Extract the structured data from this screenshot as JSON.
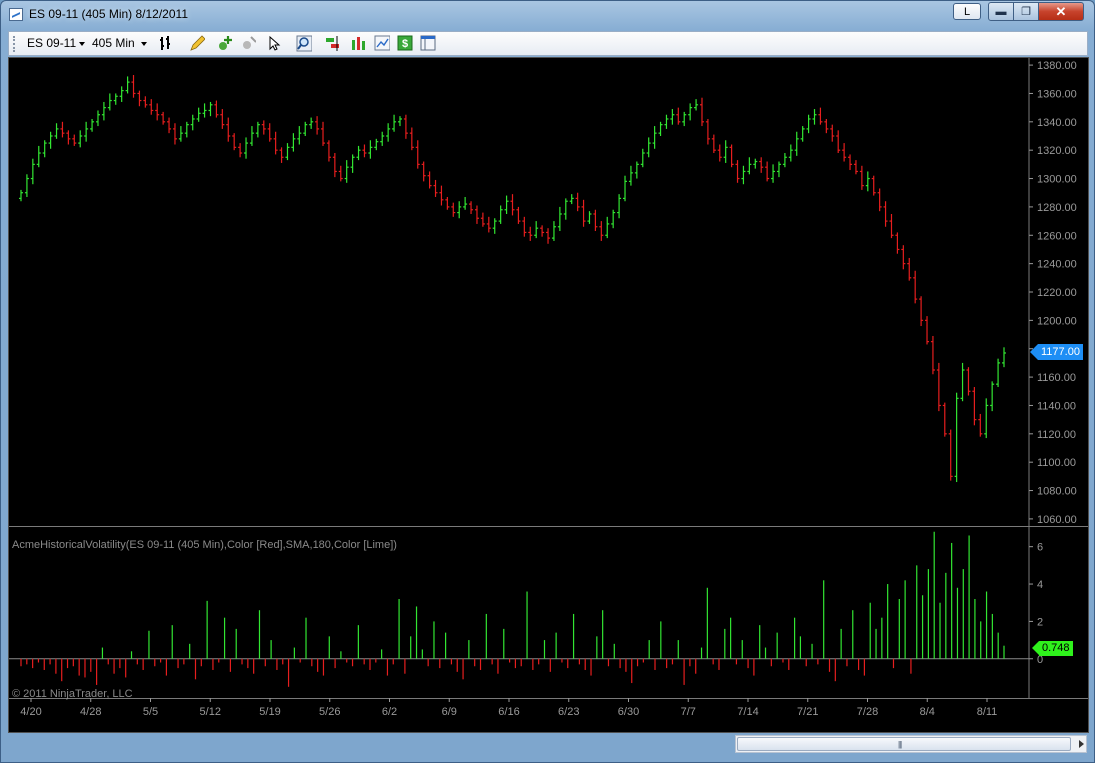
{
  "window": {
    "title": "ES 09-11 (405 Min)  8/12/2011",
    "btn_l": "L",
    "btn_min": "▬",
    "btn_max": "❐",
    "btn_close": "✕"
  },
  "toolbar": {
    "instrument": "ES 09-11",
    "interval": "405 Min",
    "icons": [
      "bar-type-icon",
      "pencil-draw-icon",
      "add-indicator-icon",
      "strategy-icon",
      "cursor-icon",
      "zoom-icon",
      "buy-sell-icon",
      "bar-chart-icon",
      "data-box-icon",
      "dollar-icon",
      "properties-icon"
    ]
  },
  "chart": {
    "indicator_label": "AcmeHistoricalVolatility(ES 09-11 (405 Min),Color [Red],SMA,180,Color [Lime])",
    "copyright": "© 2011 NinjaTrader, LLC",
    "last_price": "1177.00",
    "last_indicator": "0.748"
  },
  "chart_data": [
    {
      "type": "ohlc",
      "series_colors": {
        "up": "#32e632",
        "down": "#e61e1e"
      },
      "ylim": [
        1055,
        1385
      ],
      "y_ticks": [
        "1380.00",
        "1360.00",
        "1340.00",
        "1320.00",
        "1300.00",
        "1280.00",
        "1260.00",
        "1240.00",
        "1220.00",
        "1200.00",
        "1180.00",
        "1160.00",
        "1140.00",
        "1120.00",
        "1100.00",
        "1080.00",
        "1060.00"
      ],
      "x_ticks": [
        "4/20",
        "4/28",
        "5/5",
        "5/12",
        "5/19",
        "5/26",
        "6/2",
        "6/9",
        "6/16",
        "6/23",
        "6/30",
        "7/7",
        "7/14",
        "7/21",
        "7/28",
        "8/4",
        "8/11"
      ],
      "closes": [
        1290,
        1300,
        1310,
        1318,
        1325,
        1330,
        1335,
        1332,
        1328,
        1325,
        1330,
        1335,
        1340,
        1345,
        1350,
        1355,
        1358,
        1362,
        1368,
        1360,
        1355,
        1352,
        1348,
        1345,
        1340,
        1335,
        1328,
        1332,
        1338,
        1342,
        1346,
        1348,
        1352,
        1345,
        1338,
        1330,
        1322,
        1318,
        1325,
        1332,
        1338,
        1335,
        1328,
        1320,
        1315,
        1322,
        1328,
        1332,
        1338,
        1340,
        1335,
        1325,
        1315,
        1305,
        1300,
        1308,
        1315,
        1320,
        1318,
        1322,
        1326,
        1330,
        1335,
        1340,
        1342,
        1332,
        1322,
        1310,
        1302,
        1295,
        1290,
        1285,
        1280,
        1276,
        1280,
        1282,
        1278,
        1272,
        1268,
        1265,
        1270,
        1278,
        1284,
        1278,
        1270,
        1262,
        1260,
        1265,
        1262,
        1258,
        1266,
        1275,
        1284,
        1286,
        1280,
        1270,
        1275,
        1266,
        1260,
        1268,
        1276,
        1286,
        1298,
        1304,
        1310,
        1318,
        1325,
        1332,
        1338,
        1342,
        1345,
        1340,
        1345,
        1350,
        1352,
        1340,
        1328,
        1320,
        1315,
        1322,
        1310,
        1300,
        1305,
        1310,
        1312,
        1308,
        1300,
        1305,
        1310,
        1315,
        1320,
        1328,
        1335,
        1342,
        1345,
        1340,
        1335,
        1330,
        1320,
        1315,
        1310,
        1305,
        1295,
        1300,
        1290,
        1280,
        1270,
        1260,
        1250,
        1240,
        1230,
        1215,
        1200,
        1185,
        1165,
        1140,
        1120,
        1090,
        1145,
        1165,
        1150,
        1130,
        1120,
        1140,
        1155,
        1170,
        1177
      ],
      "volatility": [
        -0.4,
        -0.3,
        -0.5,
        -0.2,
        -0.6,
        -0.3,
        -0.8,
        -1.2,
        -0.5,
        -0.4,
        -0.9,
        -1.0,
        -0.7,
        -1.4,
        0.6,
        -0.3,
        -0.8,
        -0.5,
        -1.0,
        0.4,
        -0.3,
        -0.6,
        1.5,
        -0.4,
        -0.2,
        -0.9,
        1.8,
        -0.5,
        -0.3,
        0.8,
        -1.1,
        -0.4,
        3.1,
        -0.6,
        -0.2,
        2.2,
        -0.7,
        1.6,
        -0.3,
        -0.5,
        -0.8,
        2.6,
        -0.4,
        1.0,
        -0.6,
        -0.3,
        -1.5,
        0.6,
        -0.2,
        2.2,
        -0.4,
        -0.7,
        -0.9,
        1.2,
        -0.5,
        0.4,
        -0.2,
        -0.4,
        1.8,
        -0.3,
        -0.6,
        -0.2,
        0.5,
        -0.9,
        -0.3,
        3.2,
        -0.8,
        1.2,
        2.8,
        0.5,
        -0.4,
        2.0,
        -0.5,
        1.4,
        -0.3,
        -0.7,
        -1.1,
        1.0,
        -0.4,
        -0.6,
        2.4,
        -0.3,
        -0.8,
        1.6,
        -0.2,
        -0.5,
        -0.4,
        3.6,
        -0.6,
        -0.3,
        1.0,
        -0.7,
        1.4,
        -0.2,
        -0.5,
        2.4,
        -0.3,
        -0.6,
        -0.9,
        1.2,
        2.6,
        -0.4,
        0.8,
        -0.5,
        -0.7,
        -1.3,
        -0.4,
        -0.2,
        1.0,
        -0.6,
        2.0,
        -0.5,
        -0.3,
        1.0,
        -1.4,
        -0.4,
        -0.8,
        0.6,
        3.8,
        -0.3,
        -0.6,
        1.6,
        2.2,
        -0.3,
        1.0,
        -0.5,
        -0.9,
        1.8,
        0.6,
        -0.4,
        1.4,
        -0.2,
        -0.6,
        2.2,
        1.2,
        -0.4,
        0.8,
        -0.3,
        4.2,
        -0.7,
        -1.2,
        1.6,
        -0.4,
        2.6,
        -0.6,
        -0.9,
        3.0,
        1.6,
        2.2,
        4.0,
        -0.5,
        3.2,
        4.2,
        -0.8,
        5.0,
        3.4,
        4.8,
        6.8,
        3.0,
        4.6,
        6.2,
        3.8,
        4.8,
        6.6,
        3.2,
        2.0,
        3.6,
        2.4,
        1.4,
        0.7
      ]
    }
  ]
}
